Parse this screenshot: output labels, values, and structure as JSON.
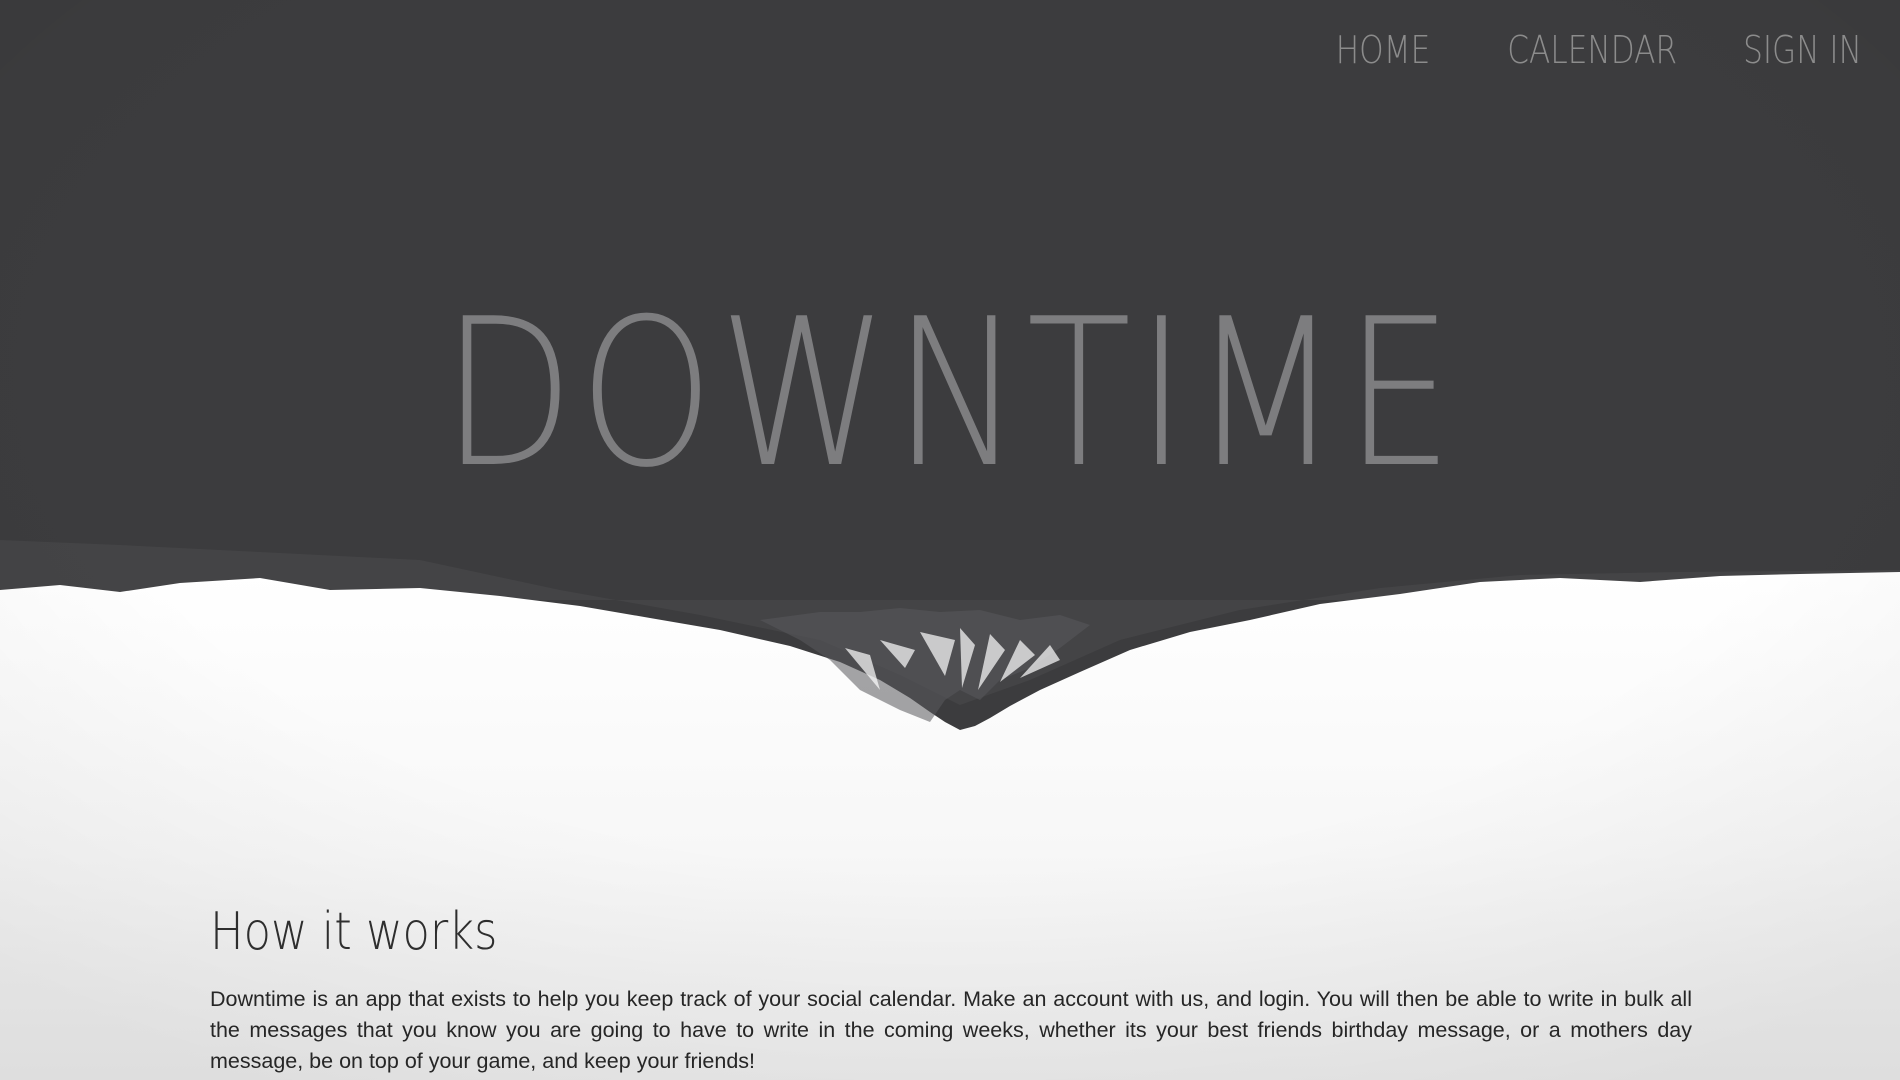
{
  "nav": {
    "home": "HOME",
    "calendar": "CALENDAR",
    "sign_in": "SIGN IN"
  },
  "hero": {
    "brand": "DOWNTIME"
  },
  "section": {
    "heading": "How it works",
    "body": "Downtime is an app that exists to help you keep track of your social calendar. Make an account with us, and login. You will then be able to write in bulk all the messages that you know you are going to have to write in the coming weeks, whether its your best friends birthday message, or a mothers day message, be on top of your game, and keep your friends!"
  },
  "colors": {
    "background_dark": "#3c3c3e",
    "background_light": "#f4f4f4",
    "nav_text": "#8c8c8c",
    "brand_text": "#7d7d7f"
  }
}
